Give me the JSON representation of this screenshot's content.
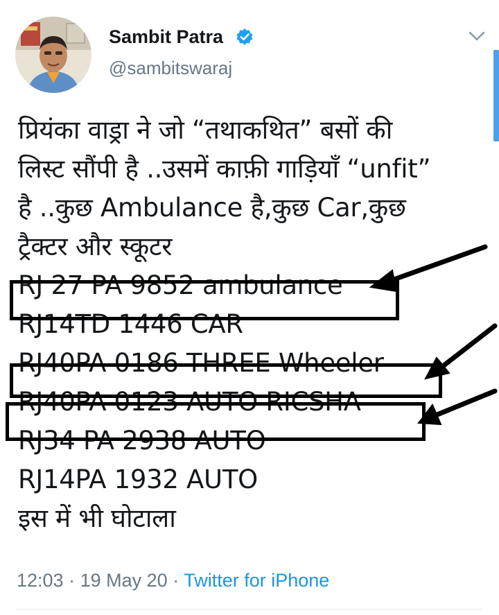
{
  "user": {
    "display_name": "Sambit Patra",
    "handle": "@sambitswaraj",
    "verified": true
  },
  "tweet": {
    "lines": [
      "प्रियंका वाड्रा ने जो “तथाकथित” बसों की",
      "लिस्ट सौंपी है ..उसमें काफ़ी गाड़ियाँ “unfit”",
      "है ..कुछ Ambulance है,कुछ Car,कुछ",
      "ट्रैक्टर और स्कूटर",
      "RJ 27 PA 9852 ambulance",
      "RJ14TD 1446 CAR",
      "RJ40PA 0186 THREE Wheeler",
      "RJ40PA 0123 AUTO RICSHA",
      "RJ34 PA 2938 AUTO",
      "RJ14PA 1932 AUTO",
      "इस में भी घोटाला"
    ],
    "time": "12:03",
    "separator": "·",
    "date": "19 May 20",
    "source": "Twitter for iPhone"
  },
  "icons": {
    "verified": "verified-badge-icon",
    "menu": "chevron-down-icon"
  },
  "colors": {
    "text": "#14171a",
    "secondary": "#657786",
    "link": "#1b95e0",
    "verified": "#1da1f2",
    "annotation": "#000000"
  }
}
